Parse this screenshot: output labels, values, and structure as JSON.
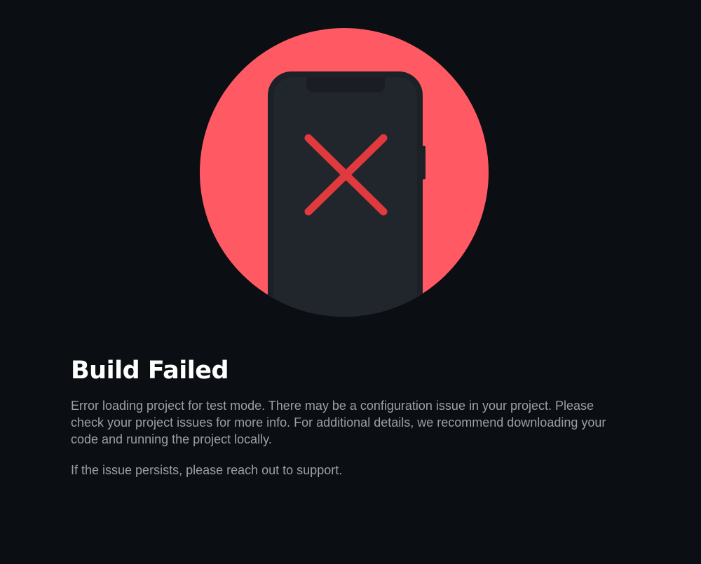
{
  "error": {
    "title": "Build Failed",
    "message": "Error loading project for test mode. There may be a configuration issue in your project. Please check your project issues for more info. For additional details, we recommend downloading your code and running the project locally.",
    "support_note": "If the issue persists, please reach out to support."
  },
  "illustration": {
    "icon": "phone-error-icon",
    "circle_color": "#ff5a64",
    "phone_color": "#1f242b",
    "x_color": "#e03a3e"
  }
}
